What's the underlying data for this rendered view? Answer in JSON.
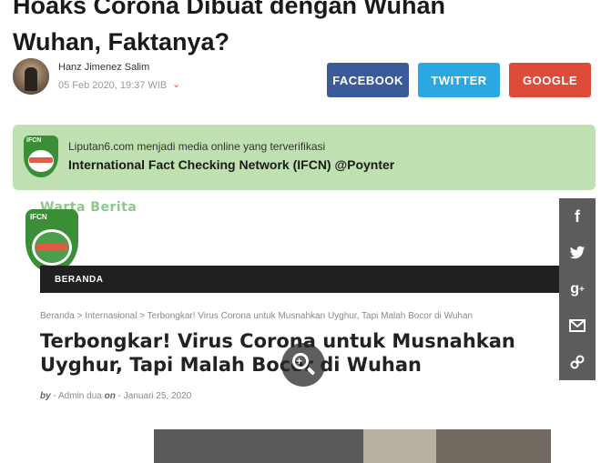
{
  "headline": {
    "line1": "Hoaks Corona Dibuat dengan Wuhan",
    "line2": "Wuhan, Faktanya?"
  },
  "author": {
    "name": "Hanz Jimenez Salim",
    "date": "05 Feb 2020, 19:37 WIB"
  },
  "share_buttons": {
    "facebook": "FACEBOOK",
    "twitter": "TWITTER",
    "google": "GOOGLE"
  },
  "ifcn": {
    "line1": "Liputan6.com menjadi media online yang terverifikasi",
    "line2": "International Fact Checking Network (IFCN) @Poynter",
    "badge_text": "IFCN"
  },
  "embed": {
    "site_title": "Warta Berita",
    "seal_text": "IFCN",
    "nav_item": "BERANDA",
    "breadcrumb": "Beranda > Internasional > Terbongkar! Virus Corona untuk Musnahkan Uyghur, Tapi Malah Bocor di Wuhan",
    "article_title_line1": "Terbongkar! Virus Corona untuk Musnahkan",
    "article_title_line2": "Uyghur, Tapi Malah Bocor di Wuhan",
    "byline_by": "by",
    "byline_author": "- Admin dua",
    "byline_on": "on",
    "byline_date": "- Januari 25, 2020"
  },
  "side_share": [
    "f",
    "t",
    "g+",
    "mail",
    "link"
  ],
  "colors": {
    "facebook": "#3b5a9a",
    "twitter": "#2ca8e0",
    "google": "#dd4b39",
    "ifcn_bg": "#bfe0b0",
    "side_bar": "#5c5c5c"
  },
  "icons": {
    "zoom": "zoom-in-icon",
    "chevron": "chevron-down-icon"
  }
}
